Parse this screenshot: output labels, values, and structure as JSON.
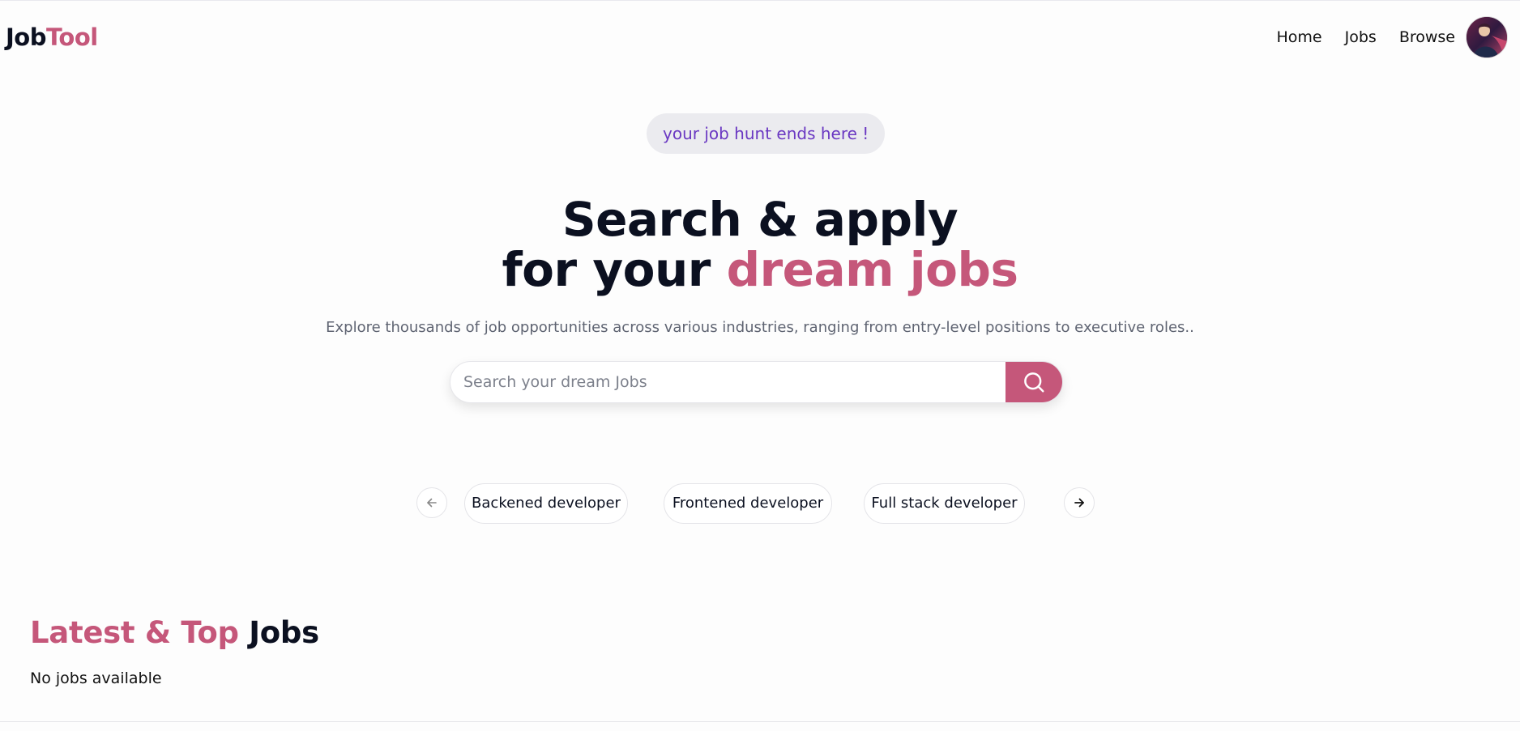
{
  "brand": {
    "name_part1": "Job",
    "name_part2": "Tool",
    "accent_color": "#c5577a",
    "badge_color": "#6a38c2"
  },
  "nav": {
    "links": [
      "Home",
      "Jobs",
      "Browse"
    ],
    "avatar_icon": "user-avatar"
  },
  "hero": {
    "badge": "your job hunt ends here !",
    "title_line1": "Search & apply",
    "title_line2_prefix": "for your ",
    "title_line2_accent": "dream jobs",
    "subtitle": "Explore thousands of job opportunities across various industries, ranging from entry-level positions to executive roles.."
  },
  "search": {
    "placeholder": "Search your dream Jobs",
    "value": "",
    "button_icon": "search-icon"
  },
  "categories": {
    "prev_icon": "arrow-left-icon",
    "next_icon": "arrow-right-icon",
    "items": [
      "Backened developer",
      "Frontened developer",
      "Full stack developer"
    ]
  },
  "latest": {
    "title_accent": "Latest & Top",
    "title_dark": "Jobs",
    "empty_message": "No jobs available"
  }
}
